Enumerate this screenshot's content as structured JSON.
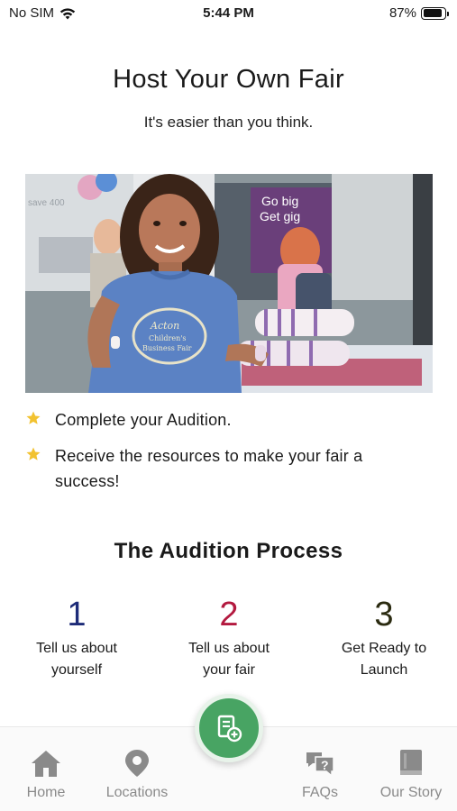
{
  "status_bar": {
    "carrier": "No SIM",
    "time": "5:44 PM",
    "battery_percent": "87%",
    "battery_level": 0.87
  },
  "header": {
    "title": "Host Your Own Fair",
    "subtitle": "It's easier than you think."
  },
  "hero": {
    "icon": "photo",
    "shirt_text_line1": "Acton",
    "shirt_text_line2": "Children's",
    "shirt_text_line3": "Business Fair",
    "sign_text_line1": "Go big",
    "sign_text_line2": "Get gig",
    "store_text": "save 400"
  },
  "bullets": [
    {
      "icon": "star-icon",
      "text": "Complete your Audition."
    },
    {
      "icon": "star-icon",
      "text": "Receive the resources to make your fair a success!"
    }
  ],
  "process": {
    "title": "The Audition Process",
    "steps": [
      {
        "number": "1",
        "label_line1": "Tell us about",
        "label_line2": "yourself",
        "color": "#1d2b78"
      },
      {
        "number": "2",
        "label_line1": "Tell us about",
        "label_line2": "your fair",
        "color": "#b3193f"
      },
      {
        "number": "3",
        "label_line1": "Get Ready to",
        "label_line2": "Launch",
        "color": "#2a2a10"
      }
    ]
  },
  "tab_bar": {
    "items": [
      {
        "label": "Home",
        "icon": "home-icon"
      },
      {
        "label": "Locations",
        "icon": "location-pin-icon"
      },
      {
        "label": "FAQs",
        "icon": "chat-question-icon"
      },
      {
        "label": "Our Story",
        "icon": "book-icon"
      }
    ],
    "fab_icon": "add-document-icon"
  },
  "colors": {
    "accent_green": "#48a463",
    "star_yellow": "#f2c230",
    "tab_gray": "#8a8a8a"
  }
}
